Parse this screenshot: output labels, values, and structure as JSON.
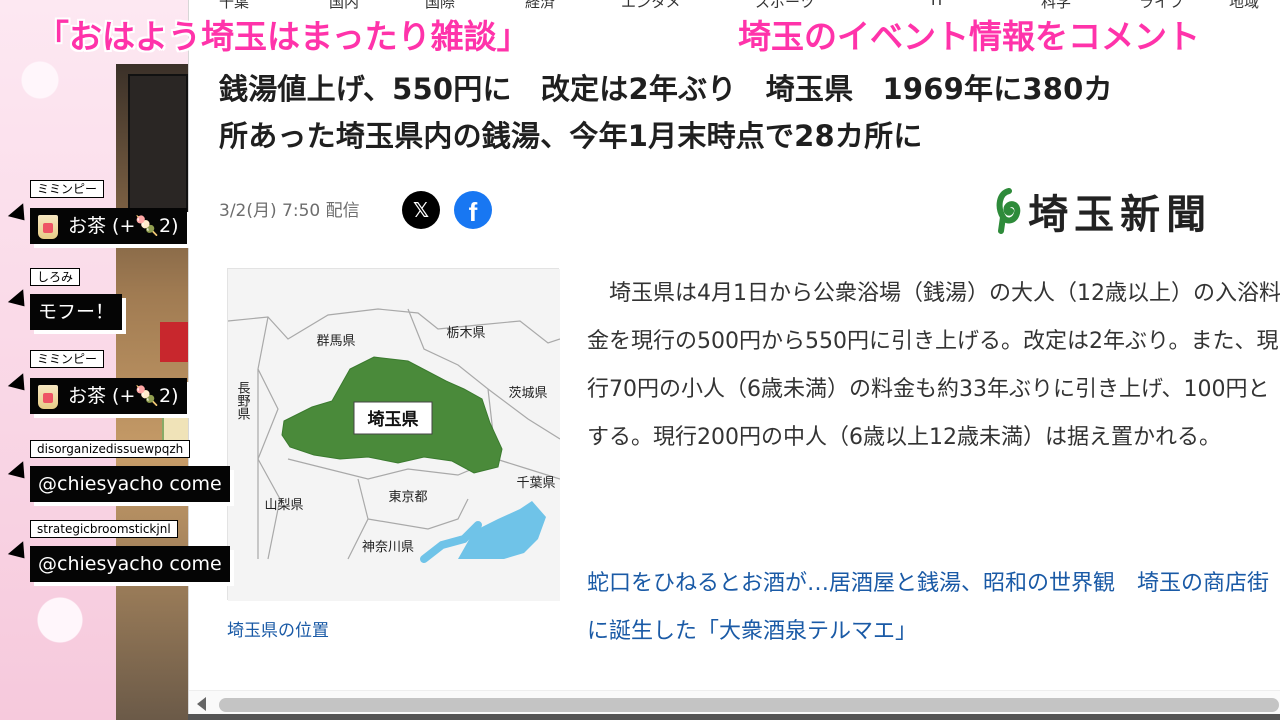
{
  "overlay": {
    "title_left": "「おはよう埼玉はまったり雑談」",
    "title_right": "埼玉のイベント情報をコメント"
  },
  "nav": {
    "items": [
      "千葉",
      "国内",
      "国際",
      "経済",
      "エンタメ",
      "スポーツ",
      "IT",
      "科学",
      "ライフ",
      "地域"
    ]
  },
  "article": {
    "headline": "銭湯値上げ、550円に　改定は2年ぶり　埼玉県　1969年に380カ所あった埼玉県内の銭湯、今年1月末時点で28カ所に",
    "headline_line1": "銭湯値上げ、550円に　改定は2年ぶり　埼玉県　1969年に380カ",
    "headline_line2": "所あった埼玉県内の銭湯、今年1月末時点で28カ所に",
    "date": "3/2(月) 7:50 配信",
    "publisher": "埼玉新聞",
    "share_x_icon": "x-logo-icon",
    "share_fb_icon": "facebook-logo-icon",
    "body": "埼玉県は4月1日から公衆浴場（銭湯）の大人（12歳以上）の入浴料金を現行の500円から550円に引き上げる。改定は2年ぶり。また、現行70円の小人（6歳未満）の料金も約33年ぶりに引き上げ、100円とする。現行200円の中人（6歳以上12歳未満）は据え置かれる。",
    "related_link": "蛇口をひねるとお酒が…居酒屋と銭湯、昭和の世界観　埼玉の商店街に誕生した「大衆酒泉テルマエ」",
    "map": {
      "caption": "埼玉県の位置",
      "labels": {
        "gunma": "群馬県",
        "tochigi": "栃木県",
        "ibaraki": "茨城県",
        "nagano": "長野県",
        "saitama": "埼玉県",
        "chiba": "千葉県",
        "yamanashi": "山梨県",
        "tokyo": "東京都",
        "kanagawa": "神奈川県"
      }
    }
  },
  "chat": [
    {
      "name": "ミミンピー",
      "text": "お茶 (+🍡2)"
    },
    {
      "name": "しろみ",
      "text": "モフー！"
    },
    {
      "name": "ミミンピー",
      "text": "お茶 (+🍡2)"
    },
    {
      "name": "disorganizedissuewpqzh",
      "text": "@chiesyacho come"
    },
    {
      "name": "strategicbroomstickjnl",
      "text": "@chiesyacho come"
    }
  ],
  "colors": {
    "overlay_text": "#ff33aa",
    "link": "#1a5aa6",
    "map_saitama": "#4a8a3a",
    "map_sea": "#6fc3e8",
    "facebook": "#1877f2"
  }
}
